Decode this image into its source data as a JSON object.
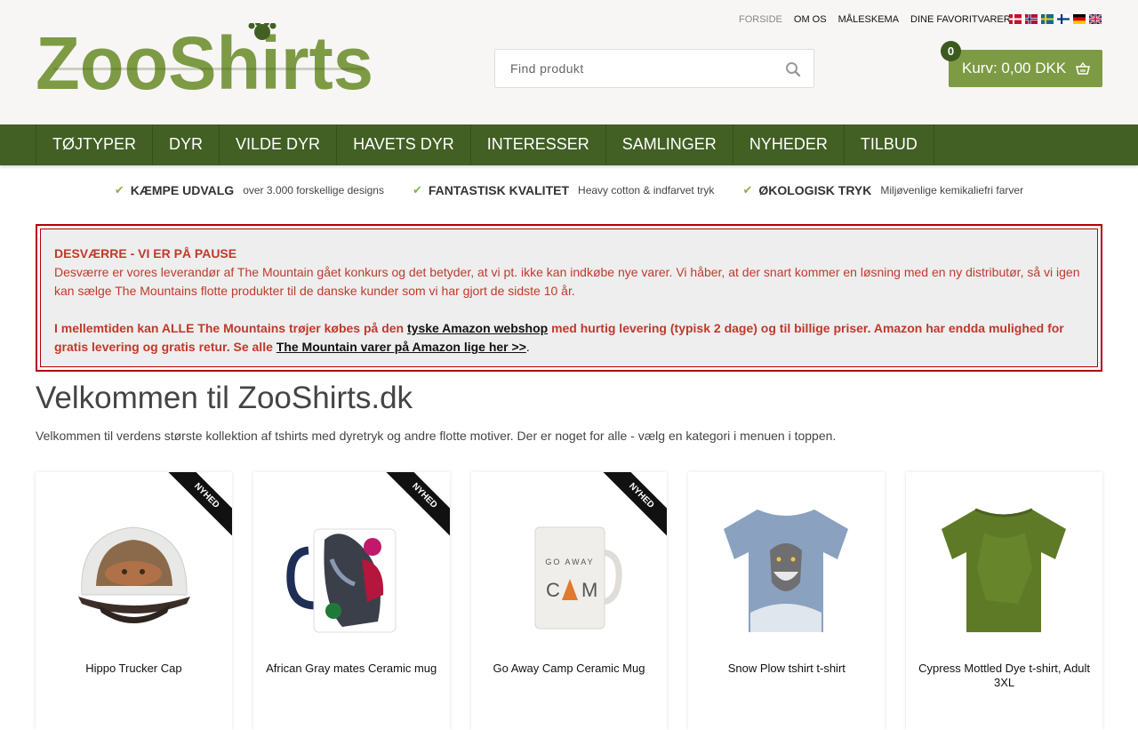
{
  "brand": {
    "name": "ZooShirts",
    "accent": "#7d9a45",
    "nav_bg": "#425f24"
  },
  "top_links": [
    "FORSIDE",
    "OM OS",
    "MÅLESKEMA",
    "DINE FAVORITVARER"
  ],
  "languages": [
    "Dansk",
    "Norsk",
    "Svenska",
    "Suomi",
    "Deutsch",
    "English"
  ],
  "search": {
    "placeholder": "Find produkt",
    "icon": "search-icon"
  },
  "cart": {
    "label": "Kurv: 0,00 DKK",
    "count": "0",
    "icon": "basket-icon"
  },
  "nav": [
    "TØJTYPER",
    "DYR",
    "VILDE DYR",
    "HAVETS DYR",
    "INTERESSER",
    "SAMLINGER",
    "NYHEDER",
    "TILBUD"
  ],
  "usps": [
    {
      "title": "KÆMPE UDVALG",
      "sub": "over 3.000 forskellige designs"
    },
    {
      "title": "FANTASTISK KVALITET",
      "sub": "Heavy cotton & indfarvet tryk"
    },
    {
      "title": "ØKOLOGISK TRYK",
      "sub": "Miljøvenlige kemikaliefri farver"
    }
  ],
  "notice": {
    "heading": "DESVÆRRE - VI ER PÅ PAUSE",
    "para1": "Desværre er vores leverandør af The Mountain gået konkurs og det betyder, at vi pt. ikke kan indkøbe nye varer. Vi håber, at der snart kommer en løsning med en ny distributør, så vi igen kan sælge The Mountains flotte produkter til de danske kunder som vi har gjort de sidste 10 år.",
    "para2_a": "I mellemtiden kan ALLE The Mountains trøjer købes på den ",
    "link1": "tyske Amazon webshop",
    "para2_b": " med hurtig levering (typisk 2 dage) og til billige priser. Amazon har endda mulighed for gratis levering og gratis retur. Se alle ",
    "link2": "The Mountain varer på Amazon lige her >>",
    "para2_c": "."
  },
  "welcome": {
    "title": "Velkommen til ZooShirts.dk",
    "text": "Velkommen til verdens største kollektion af tshirts med dyretryk og andre flotte motiver. Der er noget for alle - vælg en kategori i menuen i toppen."
  },
  "products": [
    {
      "name": "Hippo Trucker Cap",
      "badge": "NYHED"
    },
    {
      "name": "African Gray mates Ceramic mug",
      "badge": "NYHED"
    },
    {
      "name": "Go Away Camp Ceramic Mug",
      "badge": "NYHED",
      "print": "GO AWAY"
    },
    {
      "name": "Snow Plow tshirt t-shirt",
      "badge": ""
    },
    {
      "name": "Cypress Mottled Dye t-shirt, Adult 3XL",
      "badge": ""
    }
  ]
}
